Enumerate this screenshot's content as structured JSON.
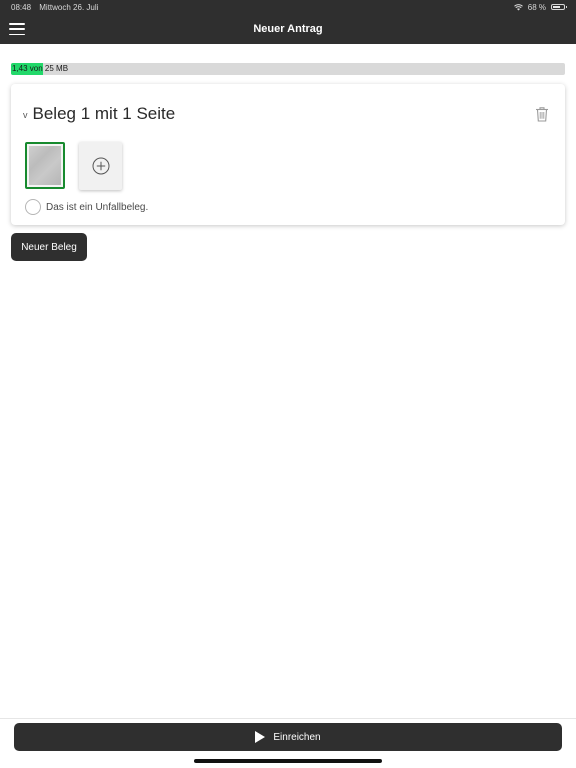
{
  "status_bar": {
    "time": "08:48",
    "date": "Mittwoch 26. Juli",
    "wifi_icon": "wifi-icon",
    "battery": "68 %",
    "battery_level": 0.68
  },
  "nav": {
    "title": "Neuer Antrag",
    "menu_icon": "hamburger-menu-icon"
  },
  "storage": {
    "text": "1,43 von 25 MB",
    "used_mb": 1.43,
    "total_mb": 25,
    "fill_color": "#22d86a"
  },
  "receipt_card": {
    "chevron": "v",
    "title": "Beleg 1 mit 1 Seite",
    "delete_icon": "trash-icon",
    "add_page_icon": "plus-circle-icon",
    "accident_label": "Das ist ein Unfallbeleg.",
    "thumbnail_border_color": "#178a2e"
  },
  "new_receipt_button": "Neuer Beleg",
  "submit_button": {
    "label": "Einreichen",
    "icon": "play-icon"
  },
  "colors": {
    "bar_background": "#2f2f2f",
    "accent_green": "#22d86a"
  }
}
